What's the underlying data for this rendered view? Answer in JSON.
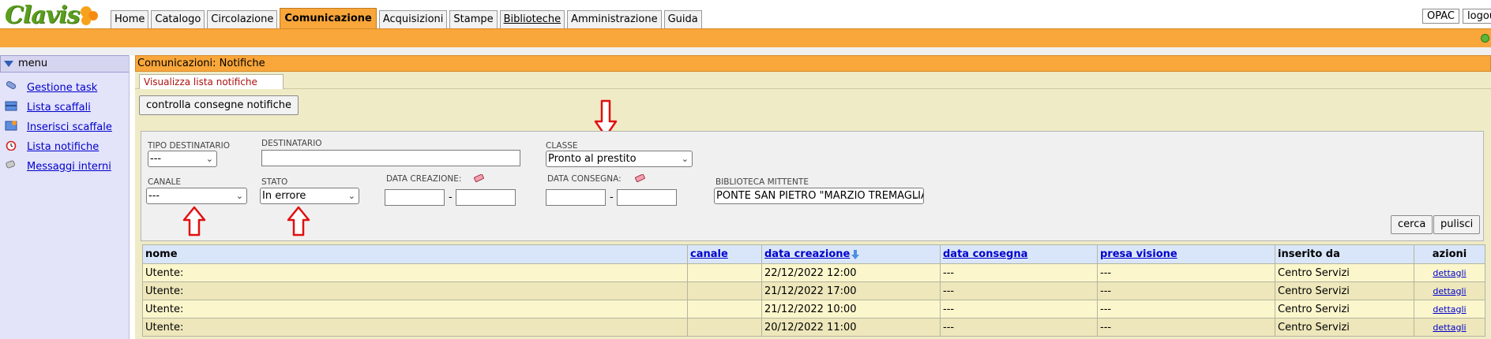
{
  "app": {
    "logo_text": "Clavis"
  },
  "nav": {
    "tabs": [
      {
        "label": "Home",
        "active": false,
        "underline": false
      },
      {
        "label": "Catalogo",
        "active": false,
        "underline": false
      },
      {
        "label": "Circolazione",
        "active": false,
        "underline": false
      },
      {
        "label": "Comunicazione",
        "active": true,
        "underline": false
      },
      {
        "label": "Acquisizioni",
        "active": false,
        "underline": false
      },
      {
        "label": "Stampe",
        "active": false,
        "underline": false
      },
      {
        "label": "Biblioteche",
        "active": false,
        "underline": true
      },
      {
        "label": "Amministrazione",
        "active": false,
        "underline": false
      },
      {
        "label": "Guida",
        "active": false,
        "underline": false
      }
    ],
    "opac_label": "OPAC",
    "logout_label": "logou"
  },
  "sidebar": {
    "title": "menu",
    "items": [
      {
        "label": "Gestione task",
        "icon": "pill-icon"
      },
      {
        "label": "Lista scaffali",
        "icon": "shelf-icon"
      },
      {
        "label": "Inserisci scaffale",
        "icon": "shelf-add-icon"
      },
      {
        "label": "Lista notifiche",
        "icon": "alarm-clock-icon"
      },
      {
        "label": "Messaggi interni",
        "icon": "message-icon"
      }
    ]
  },
  "main": {
    "title": "Comunicazioni: Notifiche",
    "subtab": "Visualizza lista notifiche",
    "check_button": "controlla consegne notifiche"
  },
  "filters": {
    "tipo_destinatario": {
      "label": "TIPO DESTINATARIO",
      "value": "---"
    },
    "destinatario": {
      "label": "DESTINATARIO",
      "value": ""
    },
    "classe": {
      "label": "CLASSE",
      "value": "Pronto al prestito"
    },
    "canale": {
      "label": "CANALE",
      "value": "---"
    },
    "stato": {
      "label": "STATO",
      "value": "In errore"
    },
    "data_creazione": {
      "label": "DATA CREAZIONE:",
      "from": "",
      "to": "",
      "separator": "-"
    },
    "data_consegna": {
      "label": "DATA CONSEGNA:",
      "from": "",
      "to": "",
      "separator": "-"
    },
    "biblioteca": {
      "label": "BIBLIOTECA MITTENTE",
      "value": "PONTE SAN PIETRO \"MARZIO TREMAGLIA\""
    },
    "search_button": "cerca",
    "clear_button": "pulisci"
  },
  "table": {
    "headers": {
      "nome": "nome",
      "canale": "canale",
      "data_creazione": "data creazione",
      "data_consegna": "data consegna",
      "presa_visione": "presa visione",
      "inserito_da": "inserito da",
      "azioni": "azioni"
    },
    "rows": [
      {
        "nome": "Utente:",
        "canale": "",
        "data_creazione": "22/12/2022 12:00",
        "data_consegna": "---",
        "presa_visione": "---",
        "inserito_da": "Centro Servizi",
        "azione": "dettagli"
      },
      {
        "nome": "Utente:",
        "canale": "",
        "data_creazione": "21/12/2022 17:00",
        "data_consegna": "---",
        "presa_visione": "---",
        "inserito_da": "Centro Servizi",
        "azione": "dettagli"
      },
      {
        "nome": "Utente:",
        "canale": "",
        "data_creazione": "21/12/2022 10:00",
        "data_consegna": "---",
        "presa_visione": "---",
        "inserito_da": "Centro Servizi",
        "azione": "dettagli"
      },
      {
        "nome": "Utente:",
        "canale": "",
        "data_creazione": "20/12/2022 11:00",
        "data_consegna": "---",
        "presa_visione": "---",
        "inserito_da": "Centro Servizi",
        "azione": "dettagli"
      }
    ]
  },
  "colors": {
    "accent_orange": "#f9a63a",
    "sidebar_bg": "#e3e3fa",
    "content_bg": "#efebc6",
    "link_blue": "#0000cc",
    "annotation_red": "#e01010"
  }
}
